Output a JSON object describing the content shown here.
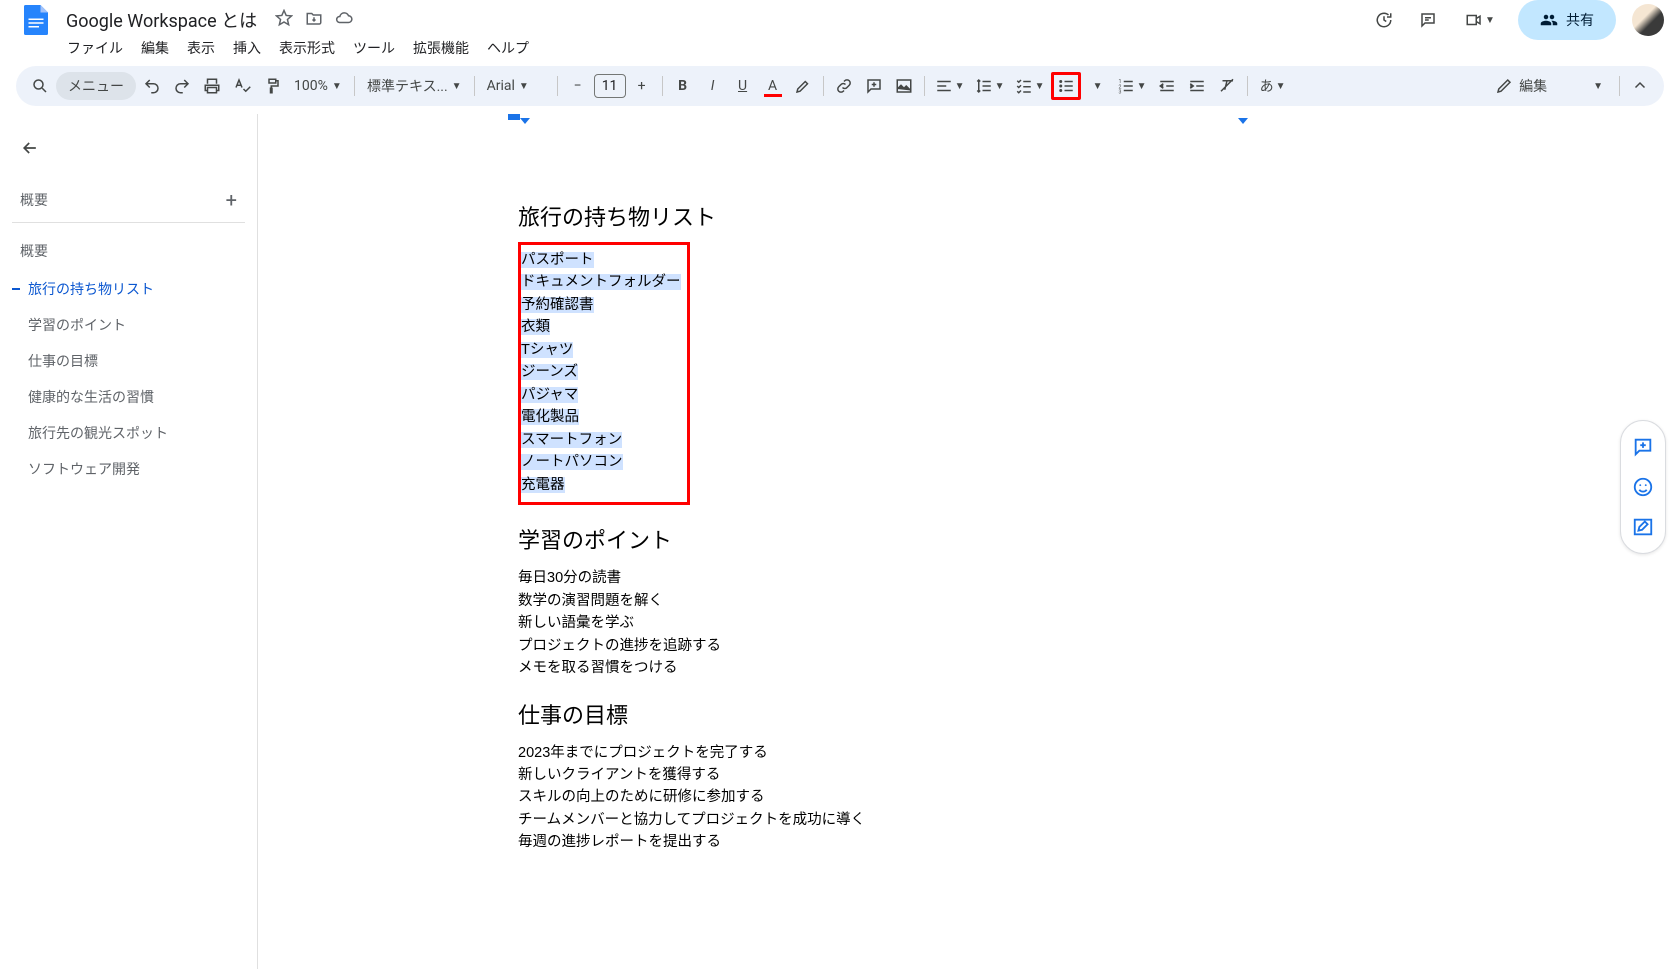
{
  "header": {
    "doc_title": "Google Workspace とは",
    "share_label": "共有"
  },
  "menus": {
    "file": "ファイル",
    "edit": "編集",
    "view": "表示",
    "insert": "挿入",
    "format": "表示形式",
    "tools": "ツール",
    "extensions": "拡張機能",
    "help": "ヘルプ"
  },
  "toolbar": {
    "menu_pill": "メニュー",
    "zoom": "100%",
    "style": "標準テキス...",
    "font": "Arial",
    "font_size": "11",
    "edit_mode": "編集",
    "ime": "あ"
  },
  "sidebar": {
    "summary_label": "概要",
    "summary2": "概要",
    "items": [
      "旅行の持ち物リスト",
      "学習のポイント",
      "仕事の目標",
      "健康的な生活の習慣",
      "旅行先の観光スポット",
      "ソフトウェア開発"
    ]
  },
  "document": {
    "sections": [
      {
        "heading": "旅行の持ち物リスト",
        "lines": [
          "パスポート",
          "ドキュメントフォルダー",
          "予約確認書",
          "衣類",
          "Tシャツ",
          "ジーンズ",
          "パジャマ",
          "電化製品",
          "スマートフォン",
          "ノートパソコン",
          "充電器"
        ],
        "selected": true,
        "boxed": true
      },
      {
        "heading": "学習のポイント",
        "lines": [
          "毎日30分の読書",
          "数学の演習問題を解く",
          "新しい語彙を学ぶ",
          "プロジェクトの進捗を追跡する",
          "メモを取る習慣をつける"
        ],
        "selected": false,
        "boxed": false
      },
      {
        "heading": "仕事の目標",
        "lines": [
          "2023年までにプロジェクトを完了する",
          "新しいクライアントを獲得する",
          "スキルの向上のために研修に参加する",
          "チームメンバーと協力してプロジェクトを成功に導く",
          "毎週の進捗レポートを提出する"
        ],
        "selected": false,
        "boxed": false
      }
    ]
  }
}
